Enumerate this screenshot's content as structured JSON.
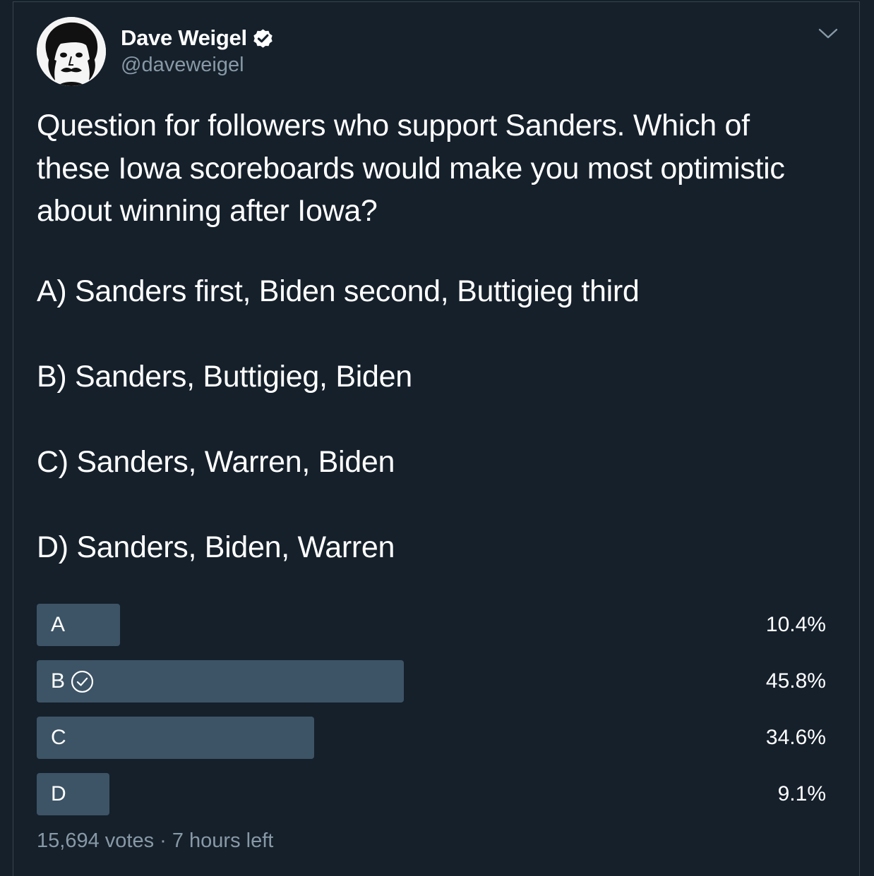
{
  "author": {
    "name": "Dave Weigel",
    "handle": "@daveweigel",
    "verified": true,
    "avatar_icon": "avatar-illustration-icon",
    "verified_icon": "verified-badge-icon"
  },
  "menu_icon": "chevron-down-icon",
  "tweet": {
    "question_lines": [
      "Question for followers who support Sanders. Which of",
      "these Iowa scoreboards would make you most optimistic",
      "about winning after Iowa?"
    ],
    "options": [
      "A) Sanders first, Biden second, Buttigieg third",
      "B) Sanders, Buttigieg, Biden",
      "C) Sanders, Warren, Biden",
      "D) Sanders, Biden, Warren"
    ]
  },
  "poll": {
    "choices": [
      {
        "label": "A",
        "percent": "10.4%",
        "value": 10.4,
        "selected": false
      },
      {
        "label": "B",
        "percent": "45.8%",
        "value": 45.8,
        "selected": true
      },
      {
        "label": "C",
        "percent": "34.6%",
        "value": 34.6,
        "selected": false
      },
      {
        "label": "D",
        "percent": "9.1%",
        "value": 9.1,
        "selected": false
      }
    ],
    "votes": "15,694 votes",
    "separator": " · ",
    "time_left": "7 hours left",
    "bar_color": "#3d5466"
  },
  "colors": {
    "background": "#15202b",
    "text": "#ffffff",
    "secondary": "#8899a6"
  }
}
